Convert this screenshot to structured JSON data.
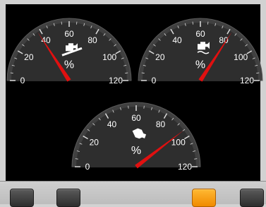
{
  "gauges": [
    {
      "id": "engine-gauge-left",
      "icon": "engine-icon",
      "unit": "%",
      "value": 38,
      "ticks": [
        "0",
        "20",
        "40",
        "60",
        "80",
        "100",
        "120"
      ]
    },
    {
      "id": "engine-gauge-right",
      "icon": "engine-temperature-icon",
      "unit": "%",
      "value": 82,
      "ticks": [
        "0",
        "20",
        "40",
        "60",
        "80",
        "100",
        "120"
      ]
    },
    {
      "id": "transmission-gauge",
      "icon": "transmission-icon",
      "unit": "%",
      "value": 95,
      "ticks": [
        "0",
        "20",
        "40",
        "60",
        "80",
        "100",
        "120"
      ]
    }
  ],
  "toolbar": {
    "buttons": [
      "button-1",
      "button-2",
      "button-3",
      "button-4"
    ],
    "active_index": 2,
    "active_color": "#f49a10"
  },
  "colors": {
    "panel_bg": "#000000",
    "gauge_face": "#3a3a3a",
    "needle": "#e01010",
    "tick": "#ffffff"
  }
}
